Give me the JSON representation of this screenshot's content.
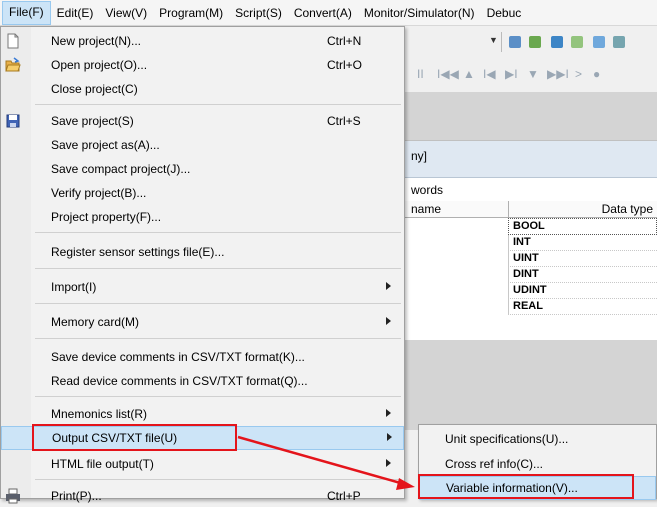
{
  "menubar": [
    {
      "label": "File(F)",
      "active": true
    },
    {
      "label": "Edit(E)"
    },
    {
      "label": "View(V)"
    },
    {
      "label": "Program(M)"
    },
    {
      "label": "Script(S)"
    },
    {
      "label": "Convert(A)"
    },
    {
      "label": "Monitor/Simulator(N)"
    },
    {
      "label": "Debuc"
    }
  ],
  "file_menu": [
    {
      "label": "New project(N)...",
      "shortcut": "Ctrl+N",
      "icon": "new-file-icon"
    },
    {
      "label": "Open project(O)...",
      "shortcut": "Ctrl+O",
      "icon": "open-folder-icon"
    },
    {
      "label": "Close project(C)"
    },
    {
      "label": "Save project(S)",
      "shortcut": "Ctrl+S",
      "icon": "save-icon"
    },
    {
      "label": "Save project as(A)..."
    },
    {
      "label": "Save compact project(J)..."
    },
    {
      "label": "Verify project(B)..."
    },
    {
      "label": "Project property(F)..."
    },
    {
      "label": "Register sensor settings file(E)..."
    },
    {
      "label": "Import(I)",
      "submenu": true
    },
    {
      "label": "Memory card(M)",
      "submenu": true
    },
    {
      "label": "Save device comments in CSV/TXT format(K)..."
    },
    {
      "label": "Read device comments in CSV/TXT format(Q)..."
    },
    {
      "label": "Mnemonics list(R)",
      "submenu": true
    },
    {
      "label": "Output CSV/TXT file(U)",
      "submenu": true,
      "highlighted": true
    },
    {
      "label": "HTML file output(T)",
      "submenu": true
    },
    {
      "label": "Print(P)...",
      "shortcut": "Ctrl+P",
      "icon": "printer-icon"
    }
  ],
  "submenu_output_csv": [
    {
      "label": "Unit specifications(U)..."
    },
    {
      "label": "Cross ref info(C)..."
    },
    {
      "label": "Variable information(V)...",
      "highlighted": true
    }
  ],
  "background_panel": {
    "title_fragment": "ny]",
    "subtitle_fragment": "words",
    "col_name": "name",
    "col_type": "Data type",
    "types": [
      "BOOL",
      "INT",
      "UINT",
      "DINT",
      "UDINT",
      "REAL"
    ]
  },
  "toolbar_glyphs": [
    "II",
    "I◀◀",
    "▲",
    "I◀",
    "▶I",
    "▼",
    "▶▶I",
    ">",
    "●"
  ],
  "colors": {
    "highlight": "#cce4f7",
    "highlight_border": "#99c9ef",
    "annotation_red": "#e4141b",
    "menu_bg": "#f2f2f2"
  }
}
